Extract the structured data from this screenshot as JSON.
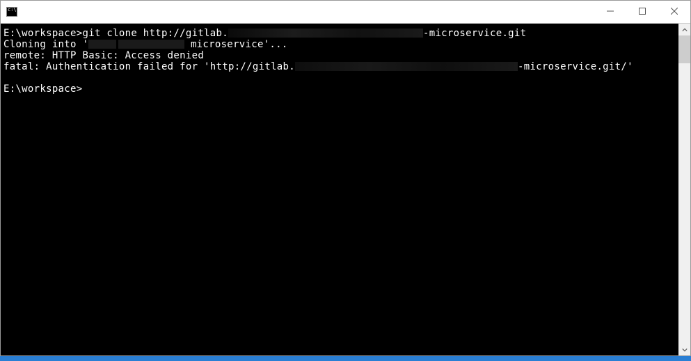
{
  "titlebar": {
    "title": ""
  },
  "terminal": {
    "line1_prompt": "E:\\workspace>",
    "line1_cmd": "git clone http://gitlab.",
    "line1_suffix": "-microservice.git",
    "line2_prefix": "Cloning into '",
    "line2_mid": "microservice'...",
    "line3": "remote: HTTP Basic: Access denied",
    "line4_prefix": "fatal: Authentication failed for 'http://gitlab.",
    "line4_suffix": "-microservice.git/'",
    "line6_prompt": "E:\\workspace>"
  }
}
